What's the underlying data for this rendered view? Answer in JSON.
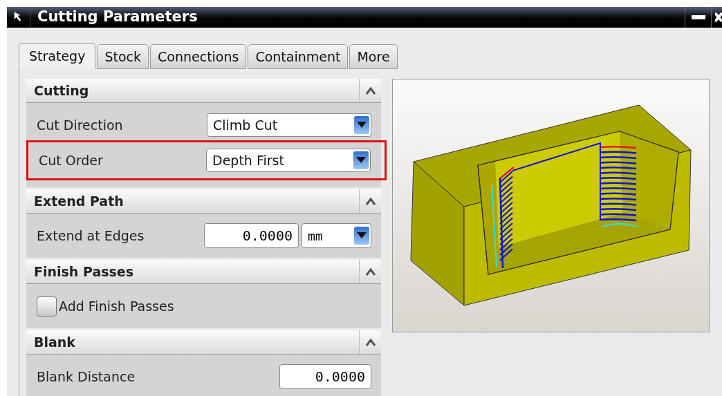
{
  "window": {
    "title": "Cutting Parameters"
  },
  "tabs": [
    {
      "label": "Strategy",
      "selected": true
    },
    {
      "label": "Stock",
      "selected": false
    },
    {
      "label": "Connections",
      "selected": false
    },
    {
      "label": "Containment",
      "selected": false
    },
    {
      "label": "More",
      "selected": false
    }
  ],
  "sections": [
    {
      "title": "Cutting",
      "expanded": true,
      "rows": [
        {
          "kind": "dropdown",
          "label": "Cut Direction",
          "value": "Climb Cut",
          "highlighted": false
        },
        {
          "kind": "dropdown",
          "label": "Cut Order",
          "value": "Depth First",
          "highlighted": true
        }
      ]
    },
    {
      "title": "Extend Path",
      "expanded": true,
      "rows": [
        {
          "kind": "number_unit",
          "label": "Extend at Edges",
          "value": "0.0000",
          "unit": "mm",
          "highlighted": false
        }
      ]
    },
    {
      "title": "Finish Passes",
      "expanded": true,
      "rows": [
        {
          "kind": "checkbox",
          "label": "Add Finish Passes",
          "checked": false,
          "highlighted": false
        }
      ]
    },
    {
      "title": "Blank",
      "expanded": true,
      "rows": [
        {
          "kind": "number",
          "label": "Blank Distance",
          "value": "0.0000",
          "highlighted": false
        }
      ]
    }
  ]
}
